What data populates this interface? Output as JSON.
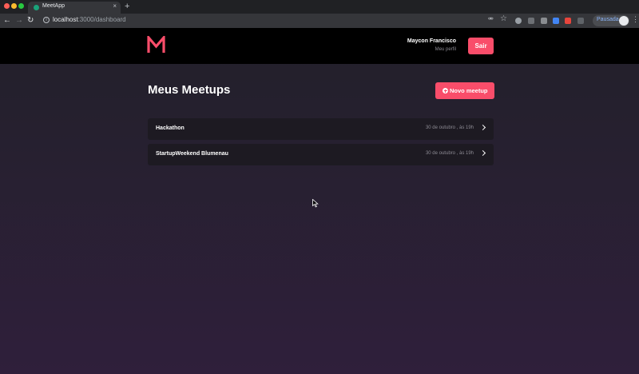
{
  "browser": {
    "tab_title": "MeetApp",
    "tab_close": "×",
    "new_tab": "+",
    "url_host": "localhost",
    "url_path": ":3000/dashboard",
    "profile_label": "Pausada",
    "icons": [
      "back-icon",
      "forward-icon",
      "reload-icon",
      "info-icon",
      "key-icon",
      "star-icon",
      "menu-icon"
    ]
  },
  "header": {
    "user_name": "Maycon Francisco",
    "profile_link": "Meu perfil",
    "logout_label": "Sair",
    "brand_color": "#f94d6a"
  },
  "main": {
    "title": "Meus Meetups",
    "new_button_label": "Novo meetup",
    "meetups": [
      {
        "title": "Hackathon",
        "date": "30 de outubro , às 19h"
      },
      {
        "title": "StartupWeekend Blumenau",
        "date": "30 de outubro , às 19h"
      }
    ]
  }
}
